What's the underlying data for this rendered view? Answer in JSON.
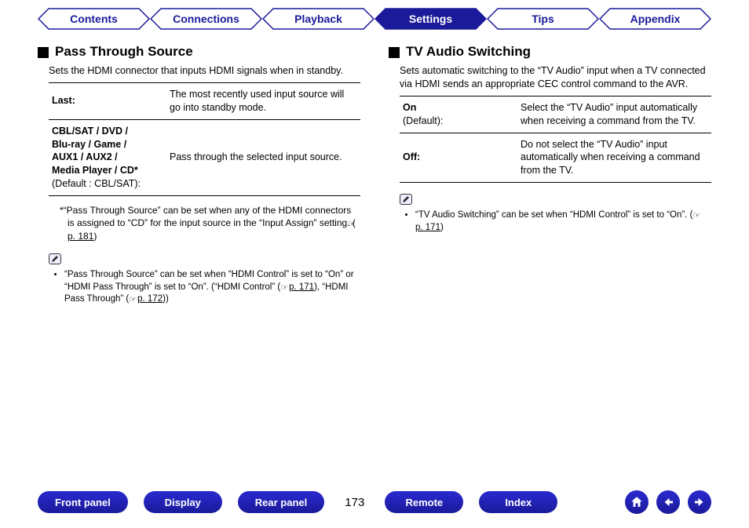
{
  "tabs": {
    "contents": "Contents",
    "connections": "Connections",
    "playback": "Playback",
    "settings": "Settings",
    "tips": "Tips",
    "appendix": "Appendix",
    "active": "settings"
  },
  "left": {
    "title": "Pass Through Source",
    "intro": "Sets the HDMI connector that inputs HDMI signals when in standby.",
    "rows": [
      {
        "key": "Last:",
        "desc": "The most recently used input source will go into standby mode."
      },
      {
        "key": "CBL/SAT / DVD /\nBlu-ray / Game /\nAUX1 / AUX2 /\nMedia Player / CD*",
        "sub": "(Default : CBL/SAT):",
        "desc": "Pass through the selected input source."
      }
    ],
    "star_note": "“Pass Through Source” can be set when any of the HDMI connectors is assigned to “CD” for the input source in the “Input Assign” setting.  (",
    "star_note_link": "p. 181",
    "star_note_end": ")",
    "bullets": [
      {
        "pre": "“Pass Through Source” can be set when “HDMI Control” is set to “On” or “HDMI Pass Through” is set to “On”. (“HDMI Control” (",
        "link1": "p. 171",
        "mid": "), “HDMI Pass Through” (",
        "link2": "p. 172",
        "post": "))"
      }
    ]
  },
  "right": {
    "title": "TV Audio Switching",
    "intro": "Sets automatic switching to the “TV Audio” input when a TV connected via HDMI sends an appropriate CEC control command to the AVR.",
    "rows": [
      {
        "key": "On",
        "sub": "(Default):",
        "desc": "Select the “TV Audio” input automatically when receiving a command from the TV."
      },
      {
        "key": "Off:",
        "desc": "Do not select the “TV Audio” input automatically when receiving a command from the TV."
      }
    ],
    "bullets": [
      {
        "pre": "“TV Audio Switching” can be set when “HDMI Control” is set to “On”. (",
        "link1": "p. 171",
        "post": ")"
      }
    ]
  },
  "footer": {
    "front_panel": "Front panel",
    "display": "Display",
    "rear_panel": "Rear panel",
    "page": "173",
    "remote": "Remote",
    "index": "Index"
  }
}
